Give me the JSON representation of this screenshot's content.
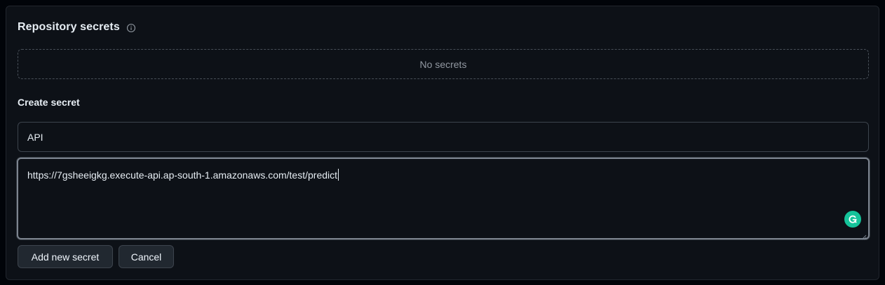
{
  "section": {
    "title": "Repository secrets",
    "info_icon": "info-icon",
    "empty_message": "No secrets"
  },
  "create": {
    "label": "Create secret",
    "name_value": "API",
    "secret_value": "https://7gsheeigkg.execute-api.ap-south-1.amazonaws.com/test/predict",
    "grammarly_icon": "grammarly-icon"
  },
  "actions": {
    "add_label": "Add new secret",
    "cancel_label": "Cancel"
  },
  "colors": {
    "background": "#0d1117",
    "border": "#3d444d",
    "text": "#e6edf3",
    "muted": "#9198a1",
    "grammarly": "#15c39a"
  }
}
